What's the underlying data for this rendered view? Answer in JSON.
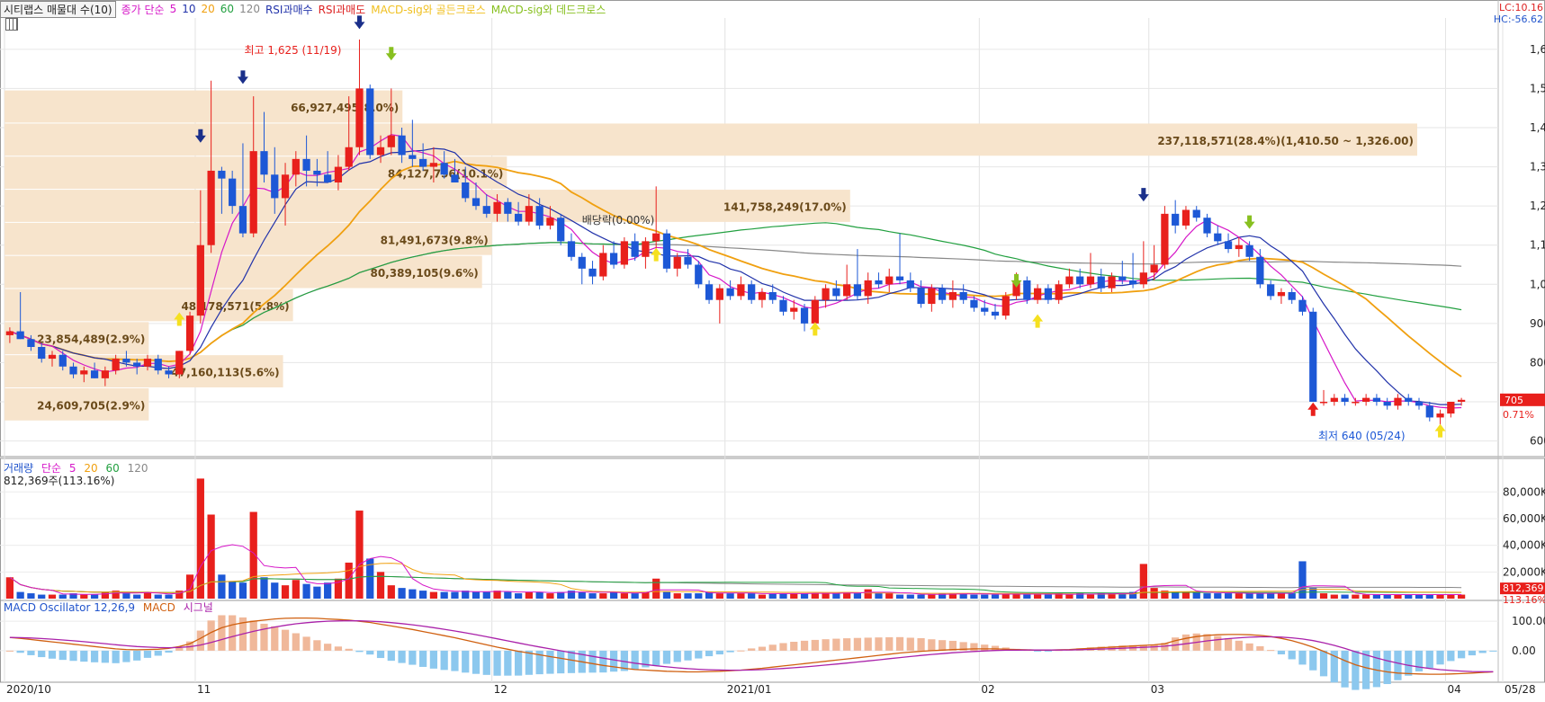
{
  "legend": {
    "title": "시티랩스 매물대 수(10)",
    "ma_label": "종가 단순",
    "ma_periods": [
      "5",
      "10",
      "20",
      "60",
      "120"
    ],
    "rsi_buy": "RSI과매수",
    "rsi_sell": "RSI과매도",
    "macd_golden": "MACD-sig와 골든크로스",
    "macd_dead": "MACD-sig와 데드크로스"
  },
  "corner": {
    "lc": "LC:10.16",
    "hc": "HC:-56.62"
  },
  "volume_panel": {
    "title": "거래량",
    "ma_label": "단순",
    "ma_periods": [
      "5",
      "20",
      "60",
      "120"
    ],
    "current": "812,369주(113.16%)",
    "ticks": [
      "80,000K",
      "60,000K",
      "40,000K",
      "20,000K"
    ],
    "last_value": "812,369",
    "last_pct": "113.16%"
  },
  "macd_panel": {
    "title": "MACD Oscillator 12,26,9",
    "macd": "MACD",
    "signal": "시그널",
    "ticks": [
      "100.00",
      "0.00"
    ]
  },
  "price_axis": {
    "ticks": [
      "1,600",
      "1,500",
      "1,400",
      "1,300",
      "1,200",
      "1,100",
      "1,000",
      "900",
      "800",
      "700",
      "600"
    ],
    "last_price": "705",
    "last_change": "0.71%"
  },
  "x_axis": {
    "labels": [
      "2020/10",
      "11",
      "12",
      "2021/01",
      "02",
      "03",
      "04",
      "05",
      "05/28"
    ]
  },
  "annotations": {
    "high": "최고 1,625 (11/19)",
    "low": "최저 640 (05/24)",
    "dividend": "배당락(0.00%)"
  },
  "colors": {
    "up": "#e8201c",
    "down": "#1d58d6",
    "ma5": "#d617c8",
    "ma10": "#2233aa",
    "ma20": "#f0a010",
    "ma60": "#22a040",
    "ma120": "#888888",
    "band": "#f7e4cc",
    "macd_hist_pos": "#f0b89a",
    "macd_hist_neg": "#8cc8ee"
  },
  "chart_data": {
    "type": "candlestick",
    "profile_bars": [
      {
        "label": "237,118,571(28.4%)(1,410.50 ~ 1,326.00)",
        "low": 1326,
        "high": 1410.5,
        "pct": 28.4
      },
      {
        "label": "66,927,495(8.0%)",
        "low": 1410.5,
        "high": 1495,
        "pct": 8.0
      },
      {
        "label": "84,127,756(10.1%)",
        "low": 1241.5,
        "high": 1326,
        "pct": 10.1
      },
      {
        "label": "141,758,249(17.0%)",
        "low": 1157,
        "high": 1241.5,
        "pct": 17.0
      },
      {
        "label": "81,491,673(9.8%)",
        "low": 1072.5,
        "high": 1157,
        "pct": 9.8
      },
      {
        "label": "80,389,105(9.6%)",
        "low": 988,
        "high": 1072.5,
        "pct": 9.6
      },
      {
        "label": "48,178,571(5.8%)",
        "low": 903.5,
        "high": 988,
        "pct": 5.8
      },
      {
        "label": "23,854,489(2.9%)",
        "low": 819,
        "high": 903.5,
        "pct": 2.9
      },
      {
        "label": "47,160,113(5.6%)",
        "low": 734.5,
        "high": 819,
        "pct": 5.6
      },
      {
        "label": "24,609,705(2.9%)",
        "low": 650,
        "high": 734.5,
        "pct": 2.9
      }
    ],
    "candles": [
      [
        870,
        890,
        850,
        880
      ],
      [
        880,
        980,
        860,
        860
      ],
      [
        860,
        870,
        830,
        840
      ],
      [
        840,
        850,
        800,
        810
      ],
      [
        810,
        830,
        790,
        820
      ],
      [
        820,
        830,
        780,
        790
      ],
      [
        790,
        800,
        760,
        770
      ],
      [
        770,
        790,
        750,
        780
      ],
      [
        780,
        800,
        760,
        760
      ],
      [
        760,
        790,
        740,
        780
      ],
      [
        780,
        820,
        770,
        810
      ],
      [
        810,
        830,
        790,
        800
      ],
      [
        800,
        810,
        770,
        790
      ],
      [
        790,
        820,
        780,
        810
      ],
      [
        810,
        820,
        770,
        780
      ],
      [
        780,
        790,
        760,
        770
      ],
      [
        770,
        830,
        760,
        830
      ],
      [
        830,
        930,
        820,
        920
      ],
      [
        920,
        1240,
        900,
        1100
      ],
      [
        1100,
        1520,
        1080,
        1290
      ],
      [
        1290,
        1300,
        1180,
        1270
      ],
      [
        1270,
        1290,
        1180,
        1200
      ],
      [
        1200,
        1360,
        1120,
        1130
      ],
      [
        1130,
        1480,
        1120,
        1340
      ],
      [
        1340,
        1440,
        1260,
        1280
      ],
      [
        1280,
        1350,
        1180,
        1220
      ],
      [
        1220,
        1310,
        1150,
        1280
      ],
      [
        1280,
        1340,
        1250,
        1320
      ],
      [
        1320,
        1380,
        1250,
        1290
      ],
      [
        1290,
        1320,
        1250,
        1280
      ],
      [
        1280,
        1340,
        1260,
        1260
      ],
      [
        1260,
        1330,
        1240,
        1300
      ],
      [
        1300,
        1480,
        1290,
        1350
      ],
      [
        1350,
        1625,
        1330,
        1500
      ],
      [
        1500,
        1510,
        1320,
        1330
      ],
      [
        1330,
        1380,
        1310,
        1350
      ],
      [
        1350,
        1500,
        1330,
        1380
      ],
      [
        1380,
        1400,
        1310,
        1330
      ],
      [
        1330,
        1420,
        1300,
        1320
      ],
      [
        1320,
        1360,
        1290,
        1300
      ],
      [
        1300,
        1350,
        1260,
        1310
      ],
      [
        1310,
        1340,
        1270,
        1280
      ],
      [
        1280,
        1320,
        1260,
        1260
      ],
      [
        1260,
        1300,
        1210,
        1220
      ],
      [
        1220,
        1260,
        1190,
        1200
      ],
      [
        1200,
        1230,
        1170,
        1180
      ],
      [
        1180,
        1230,
        1160,
        1210
      ],
      [
        1210,
        1220,
        1160,
        1180
      ],
      [
        1180,
        1210,
        1150,
        1160
      ],
      [
        1160,
        1230,
        1150,
        1200
      ],
      [
        1200,
        1220,
        1140,
        1150
      ],
      [
        1150,
        1200,
        1140,
        1170
      ],
      [
        1170,
        1180,
        1100,
        1110
      ],
      [
        1110,
        1130,
        1060,
        1070
      ],
      [
        1070,
        1080,
        1000,
        1040
      ],
      [
        1040,
        1060,
        1000,
        1020
      ],
      [
        1020,
        1100,
        1010,
        1080
      ],
      [
        1080,
        1110,
        1040,
        1050
      ],
      [
        1050,
        1120,
        1040,
        1110
      ],
      [
        1110,
        1130,
        1060,
        1070
      ],
      [
        1070,
        1120,
        1040,
        1110
      ],
      [
        1110,
        1250,
        1090,
        1130
      ],
      [
        1130,
        1140,
        1030,
        1040
      ],
      [
        1040,
        1080,
        1020,
        1070
      ],
      [
        1070,
        1090,
        1040,
        1050
      ],
      [
        1050,
        1060,
        990,
        1000
      ],
      [
        1000,
        1010,
        950,
        960
      ],
      [
        960,
        1000,
        900,
        990
      ],
      [
        990,
        1010,
        960,
        970
      ],
      [
        970,
        1020,
        960,
        1000
      ],
      [
        1000,
        1010,
        950,
        960
      ],
      [
        960,
        990,
        940,
        980
      ],
      [
        980,
        1000,
        950,
        960
      ],
      [
        960,
        970,
        920,
        930
      ],
      [
        930,
        960,
        910,
        940
      ],
      [
        940,
        950,
        880,
        900
      ],
      [
        900,
        970,
        880,
        960
      ],
      [
        960,
        1000,
        940,
        990
      ],
      [
        990,
        1010,
        960,
        970
      ],
      [
        970,
        1050,
        960,
        1000
      ],
      [
        1000,
        1090,
        960,
        970
      ],
      [
        970,
        1030,
        950,
        1010
      ],
      [
        1010,
        1030,
        990,
        1000
      ],
      [
        1000,
        1040,
        980,
        1020
      ],
      [
        1020,
        1130,
        1000,
        1010
      ],
      [
        1010,
        1030,
        980,
        990
      ],
      [
        990,
        1010,
        940,
        950
      ],
      [
        950,
        1000,
        930,
        990
      ],
      [
        990,
        1000,
        950,
        960
      ],
      [
        960,
        1010,
        940,
        980
      ],
      [
        980,
        1000,
        950,
        960
      ],
      [
        960,
        970,
        930,
        940
      ],
      [
        940,
        960,
        920,
        930
      ],
      [
        930,
        950,
        910,
        920
      ],
      [
        920,
        980,
        910,
        970
      ],
      [
        970,
        1030,
        960,
        1010
      ],
      [
        1010,
        1020,
        950,
        960
      ],
      [
        960,
        1000,
        950,
        990
      ],
      [
        990,
        1000,
        950,
        960
      ],
      [
        960,
        1010,
        950,
        1000
      ],
      [
        1000,
        1040,
        990,
        1020
      ],
      [
        1020,
        1040,
        990,
        1000
      ],
      [
        1000,
        1080,
        990,
        1020
      ],
      [
        1020,
        1040,
        980,
        990
      ],
      [
        990,
        1030,
        980,
        1020
      ],
      [
        1020,
        1060,
        1000,
        1010
      ],
      [
        1010,
        1080,
        990,
        1000
      ],
      [
        1000,
        1110,
        990,
        1030
      ],
      [
        1030,
        1100,
        1010,
        1050
      ],
      [
        1050,
        1200,
        1040,
        1180
      ],
      [
        1180,
        1215,
        1130,
        1150
      ],
      [
        1150,
        1200,
        1140,
        1190
      ],
      [
        1190,
        1200,
        1160,
        1170
      ],
      [
        1170,
        1180,
        1120,
        1130
      ],
      [
        1130,
        1150,
        1100,
        1110
      ],
      [
        1110,
        1130,
        1080,
        1090
      ],
      [
        1090,
        1120,
        1070,
        1100
      ],
      [
        1100,
        1110,
        1060,
        1070
      ],
      [
        1070,
        1090,
        990,
        1000
      ],
      [
        1000,
        1010,
        960,
        970
      ],
      [
        970,
        990,
        950,
        980
      ],
      [
        980,
        990,
        950,
        960
      ],
      [
        960,
        970,
        920,
        930
      ],
      [
        930,
        940,
        700,
        700
      ],
      [
        700,
        730,
        690,
        700
      ],
      [
        700,
        720,
        690,
        710
      ],
      [
        710,
        720,
        690,
        700
      ],
      [
        700,
        710,
        690,
        700
      ],
      [
        700,
        720,
        690,
        710
      ],
      [
        710,
        720,
        690,
        700
      ],
      [
        700,
        710,
        680,
        690
      ],
      [
        690,
        720,
        680,
        710
      ],
      [
        710,
        720,
        690,
        700
      ],
      [
        700,
        710,
        680,
        690
      ],
      [
        690,
        700,
        650,
        660
      ],
      [
        660,
        680,
        640,
        670
      ],
      [
        670,
        700,
        660,
        700
      ],
      [
        700,
        710,
        690,
        705
      ]
    ],
    "volume": [
      16,
      5,
      4,
      3,
      3,
      3,
      4,
      3,
      3,
      5,
      6,
      4,
      3,
      5,
      3,
      3,
      6,
      18,
      90,
      63,
      18,
      13,
      12,
      65,
      16,
      12,
      10,
      14,
      11,
      9,
      12,
      15,
      27,
      66,
      30,
      20,
      10,
      8,
      7,
      6,
      5,
      5,
      5,
      6,
      5,
      5,
      6,
      5,
      4,
      5,
      5,
      4,
      5,
      6,
      5,
      4,
      4,
      5,
      4,
      4,
      5,
      15,
      5,
      4,
      4,
      4,
      5,
      4,
      4,
      4,
      4,
      3,
      4,
      4,
      4,
      4,
      4,
      4,
      4,
      5,
      4,
      7,
      4,
      4,
      3,
      3,
      3,
      3,
      4,
      4,
      4,
      3,
      3,
      3,
      4,
      4,
      3,
      3,
      3,
      4,
      3,
      4,
      3,
      4,
      4,
      4,
      5,
      26,
      8,
      6,
      5,
      5,
      5,
      4,
      4,
      4,
      4,
      4,
      4,
      4,
      4,
      4,
      28,
      8,
      4,
      3,
      3,
      3,
      3,
      3,
      3,
      3,
      3,
      3,
      3,
      3,
      3,
      3
    ],
    "macd": [
      45,
      42,
      38,
      34,
      30,
      26,
      22,
      18,
      14,
      10,
      6,
      4,
      3,
      4,
      5,
      8,
      14,
      24,
      42,
      62,
      78,
      88,
      95,
      100,
      104,
      108,
      110,
      111,
      111,
      110,
      108,
      106,
      104,
      100,
      96,
      90,
      84,
      78,
      72,
      65,
      58,
      51,
      44,
      36,
      28,
      20,
      12,
      5,
      -2,
      -8,
      -14,
      -20,
      -26,
      -32,
      -38,
      -44,
      -50,
      -55,
      -60,
      -64,
      -66,
      -68,
      -70,
      -71,
      -72,
      -72,
      -71,
      -70,
      -68,
      -66,
      -63,
      -60,
      -56,
      -52,
      -48,
      -44,
      -40,
      -36,
      -32,
      -28,
      -24,
      -20,
      -16,
      -12,
      -8,
      -5,
      -2,
      0,
      2,
      4,
      5,
      6,
      6,
      6,
      5,
      4,
      3,
      2,
      2,
      3,
      4,
      6,
      8,
      10,
      12,
      14,
      16,
      18,
      20,
      24,
      34,
      42,
      48,
      52,
      54,
      55,
      55,
      54,
      52,
      48,
      42,
      34,
      24,
      12,
      -2,
      -18,
      -34,
      -48,
      -58,
      -66,
      -72,
      -76,
      -78,
      -79,
      -80,
      -80,
      -79,
      -78,
      -76,
      -74,
      -72
    ],
    "x_labels_at": [
      0,
      18,
      46,
      68,
      92,
      108,
      136,
      146,
      167
    ],
    "ylim": [
      560,
      1680
    ]
  }
}
